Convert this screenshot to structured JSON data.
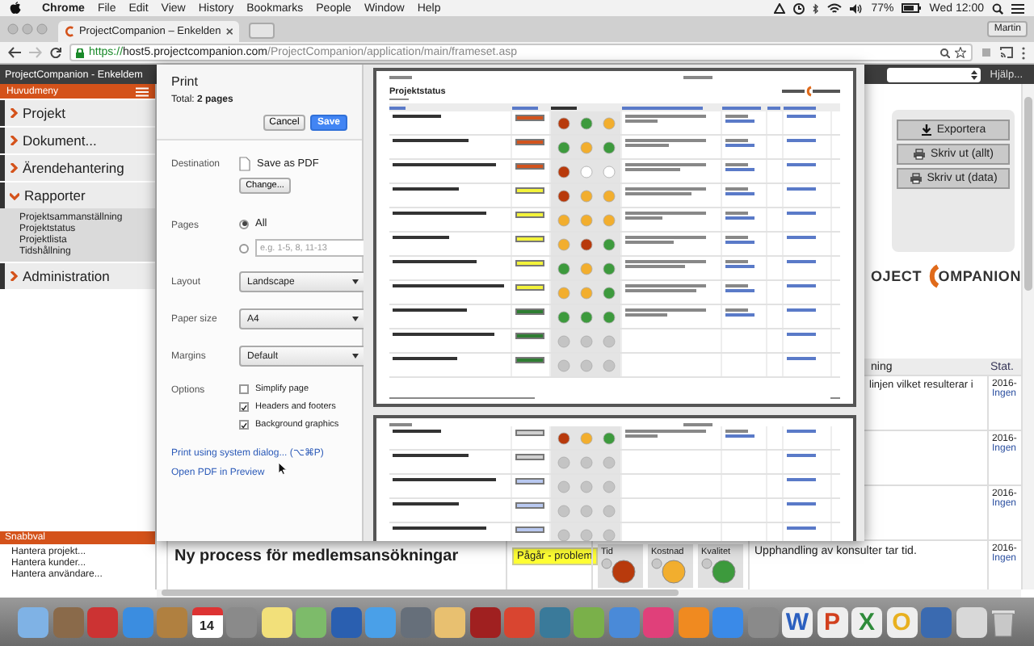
{
  "menu_bar": {
    "app": "Chrome",
    "items": [
      "File",
      "Edit",
      "View",
      "History",
      "Bookmarks",
      "People",
      "Window",
      "Help"
    ],
    "battery": "77%",
    "clock": "Wed 12:00"
  },
  "browser": {
    "tab_title": "ProjectCompanion – Enkelden",
    "profile": "Martin",
    "url_scheme": "https://",
    "url_host": "host5.projectcompanion.com",
    "url_path": "/ProjectCompanion/application/main/frameset.asp"
  },
  "app_header": {
    "title": "ProjectCompanion - Enkeldem",
    "help": "Hjälp..."
  },
  "sidebar": {
    "title": "Huvudmeny",
    "items": [
      {
        "label": "Projekt",
        "expanded": false
      },
      {
        "label": "Dokument...",
        "expanded": false
      },
      {
        "label": "Ärendehantering",
        "expanded": false
      },
      {
        "label": "Rapporter",
        "expanded": true,
        "children": [
          {
            "label": "Projektsammanställning"
          },
          {
            "label": "Projektstatus"
          },
          {
            "label": "Projektlista"
          },
          {
            "label": "Tidshållning"
          }
        ]
      },
      {
        "label": "Administration",
        "expanded": false
      }
    ]
  },
  "quick_links": {
    "title": "Snabbval",
    "items": [
      "Hantera projekt...",
      "Hantera kunder...",
      "Hantera användare..."
    ]
  },
  "actions": [
    {
      "label": "Exportera",
      "kind": "export"
    },
    {
      "label": "Skriv ut (allt)",
      "kind": "print"
    },
    {
      "label": "Skriv ut (data)",
      "kind": "print"
    }
  ],
  "logo": {
    "left": "OJECT",
    "right": "OMPANION"
  },
  "table": {
    "columns": [
      "ning",
      "Stat."
    ],
    "rows": [
      {
        "comment": "linjen vilket resulterar i",
        "date": "2016-",
        "owner": "Ingen"
      },
      {
        "date": "2016-",
        "owner": "Ingen"
      },
      {
        "date": "2016-",
        "owner": "Ingen"
      },
      {
        "project": "Ny process för medlemsansökningar",
        "status": "Pågår - problem",
        "color": "#ffff33",
        "lights": [
          {
            "label": "Tid",
            "color": "#b83a0c"
          },
          {
            "label": "Kostnad",
            "color": "#f2ae2e"
          },
          {
            "label": "Kvalitet",
            "color": "#3d9a3d"
          }
        ],
        "comment": "Upphandling av konsulter tar tid.",
        "date": "2016-",
        "owner": "Ingen"
      }
    ]
  },
  "print_dialog": {
    "title": "Print",
    "total": "Total: **2 pages**",
    "cancel": "Cancel",
    "save": "Save",
    "destination": {
      "label": "Destination",
      "value": "Save as PDF",
      "change": "Change..."
    },
    "pages": {
      "label": "Pages",
      "all": {
        "label": "All",
        "selected": true
      },
      "custom": {
        "placeholder": "e.g. 1-5, 8, 11-13",
        "selected": false
      }
    },
    "selects": [
      {
        "label": "Layout",
        "value": "Landscape"
      },
      {
        "label": "Paper size",
        "value": "A4"
      },
      {
        "label": "Margins",
        "value": "Default"
      }
    ],
    "options": {
      "label": "Options",
      "items": [
        {
          "label": "Simplify page",
          "checked": false
        },
        {
          "label": "Headers and footers",
          "checked": true
        },
        {
          "label": "Background graphics",
          "checked": true
        }
      ]
    },
    "links": [
      "Print using system dialog... (⌥⌘P)",
      "Open PDF in Preview"
    ]
  },
  "preview": {
    "pages": [
      {
        "title": "Projektstatus",
        "rows": [
          {
            "color": "#d2531d",
            "notes": true,
            "lights": [
              {
                "color": "#b83a0c"
              },
              {
                "color": "#3d9a3d"
              },
              {
                "color": "#f2ae2e"
              }
            ]
          },
          {
            "color": "#d2531d",
            "notes": true,
            "lights": [
              {
                "color": "#3d9a3d"
              },
              {
                "color": "#f2ae2e"
              },
              {
                "color": "#3d9a3d"
              }
            ]
          },
          {
            "color": "#d2531d",
            "notes": true,
            "lights": [
              {
                "color": "#b83a0c"
              },
              {
                "color": "#ffffff"
              },
              {
                "color": "#ffffff"
              }
            ]
          },
          {
            "color": "#f3f33a",
            "notes": true,
            "lights": [
              {
                "color": "#b83a0c"
              },
              {
                "color": "#f2ae2e"
              },
              {
                "color": "#f2ae2e"
              }
            ]
          },
          {
            "color": "#f3f33a",
            "notes": true,
            "lights": [
              {
                "color": "#f2ae2e"
              },
              {
                "color": "#f2ae2e"
              },
              {
                "color": "#f2ae2e"
              }
            ]
          },
          {
            "color": "#f3f33a",
            "notes": true,
            "lights": [
              {
                "color": "#f2ae2e"
              },
              {
                "color": "#b83a0c"
              },
              {
                "color": "#3d9a3d"
              }
            ]
          },
          {
            "color": "#f3f33a",
            "notes": true,
            "lights": [
              {
                "color": "#3d9a3d"
              },
              {
                "color": "#f2ae2e"
              },
              {
                "color": "#3d9a3d"
              }
            ]
          },
          {
            "color": "#f3f33a",
            "notes": true,
            "lights": [
              {
                "color": "#f2ae2e"
              },
              {
                "color": "#f2ae2e"
              },
              {
                "color": "#3d9a3d"
              }
            ]
          },
          {
            "color": "#2e7d32",
            "notes": true,
            "lights": [
              {
                "color": "#3d9a3d"
              },
              {
                "color": "#3d9a3d"
              },
              {
                "color": "#3d9a3d"
              }
            ]
          },
          {
            "color": "#2e7d32",
            "notes": false,
            "lights": [
              {
                "color": "#c4c4c4"
              },
              {
                "color": "#c4c4c4"
              },
              {
                "color": "#c4c4c4"
              }
            ]
          },
          {
            "color": "#2e7d32",
            "notes": false,
            "lights": [
              {
                "color": "#c4c4c4"
              },
              {
                "color": "#c4c4c4"
              },
              {
                "color": "#c4c4c4"
              }
            ]
          }
        ]
      },
      {
        "rows": [
          {
            "color": "#d0d0d0",
            "notes": true,
            "lights": [
              {
                "color": "#b83a0c"
              },
              {
                "color": "#f2ae2e"
              },
              {
                "color": "#3d9a3d"
              }
            ]
          },
          {
            "color": "#d0d0d0",
            "notes": false,
            "lights": [
              {
                "color": "#c4c4c4"
              },
              {
                "color": "#c4c4c4"
              },
              {
                "color": "#c4c4c4"
              }
            ]
          },
          {
            "color": "#b8c8f0",
            "notes": false,
            "lights": [
              {
                "color": "#c4c4c4"
              },
              {
                "color": "#c4c4c4"
              },
              {
                "color": "#c4c4c4"
              }
            ]
          },
          {
            "color": "#b8c8f0",
            "notes": false,
            "lights": [
              {
                "color": "#c4c4c4"
              },
              {
                "color": "#c4c4c4"
              },
              {
                "color": "#c4c4c4"
              }
            ]
          },
          {
            "color": "#b8c8f0",
            "notes": false,
            "lights": [
              {
                "color": "#c4c4c4"
              },
              {
                "color": "#c4c4c4"
              },
              {
                "color": "#c4c4c4"
              }
            ]
          }
        ]
      }
    ]
  },
  "dock": {
    "calendar_day": "14",
    "letters": [
      "W",
      "P",
      "X",
      "O"
    ]
  }
}
